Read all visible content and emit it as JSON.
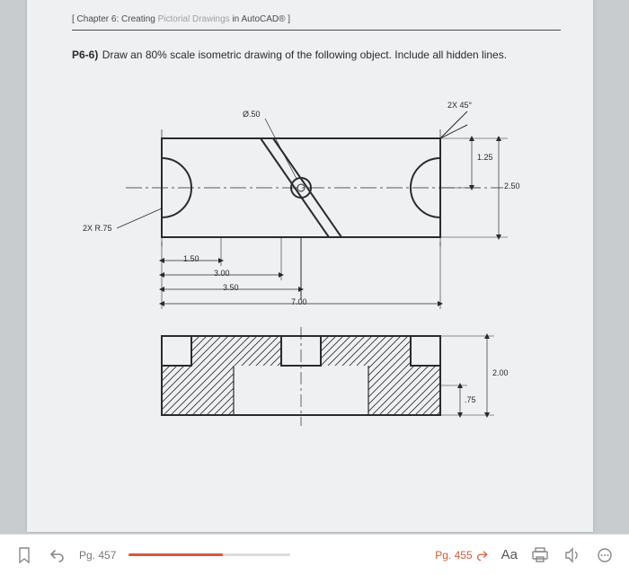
{
  "chapter": {
    "plain1": "[ Chapter 6",
    "label1": "Creating",
    "grey": "Pictorial Drawings",
    "label2": "in AutoCAD® ]"
  },
  "problem": {
    "id": "P6-6)",
    "text": "Draw an 80% scale isometric drawing of the following object.  Include all hidden lines."
  },
  "dims": {
    "d050": "Ø.50",
    "r75": "2X R.75",
    "x45": "2X 45°",
    "v125": "1.25",
    "v250": "2.50",
    "h150": "1.50",
    "h300": "3.00",
    "h350": "3.50",
    "h700": "7.00",
    "v200": "2.00",
    "v075": ".75",
    "footer": "Pg. 455"
  },
  "toolbar": {
    "page_left": "Pg. 457",
    "page_right": "Pg. 455",
    "aa": "Aa"
  }
}
